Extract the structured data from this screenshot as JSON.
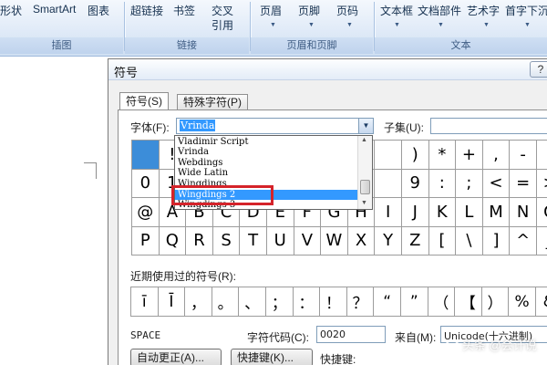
{
  "ribbon": {
    "items": [
      "形状",
      "SmartArt",
      "图表",
      "超链接",
      "书签",
      "交叉",
      "引用",
      "页眉",
      "页脚",
      "页码",
      "文本框",
      "文档部件",
      "艺术字",
      "首字下沉"
    ],
    "groups": [
      "插图",
      "链接",
      "页眉和页脚",
      "文本"
    ]
  },
  "dialog": {
    "title": "符号",
    "help": "?",
    "tabs": [
      "符号(S)",
      "特殊字符(P)"
    ],
    "font_label": "字体(F):",
    "font_value": "Vrinda",
    "subset_label": "子集(U):",
    "font_list": [
      "Vladimir Script",
      "Vrinda",
      "Webdings",
      "Wide Latin",
      "Wingdings",
      "Wingdings 2",
      "Wingdings 3"
    ],
    "font_list_highlight": "Wingdings 2",
    "symbols": [
      [
        "",
        "!",
        "",
        "",
        "",
        "",
        "",
        "",
        "",
        "",
        ")",
        "*",
        "+",
        ",",
        "-",
        "."
      ],
      [
        "0",
        "1",
        "",
        "",
        "",
        "",
        "",
        "",
        "",
        "",
        "9",
        ":",
        ";",
        "<",
        "=",
        ">"
      ],
      [
        "@",
        "A",
        "B",
        "C",
        "D",
        "E",
        "F",
        "G",
        "H",
        "I",
        "J",
        "K",
        "L",
        "M",
        "N",
        "O"
      ],
      [
        "P",
        "Q",
        "R",
        "S",
        "T",
        "U",
        "V",
        "W",
        "X",
        "Y",
        "Z",
        "[",
        "\\",
        "]",
        "^",
        "_"
      ]
    ],
    "recent_label": "近期使用过的符号(R):",
    "recent_symbols": [
      "ī",
      "Ī",
      "，",
      "。",
      "、",
      "；",
      "：",
      "！",
      "？",
      "“",
      "”",
      "（",
      "【",
      "）",
      "%",
      "&"
    ],
    "char_name": "SPACE",
    "char_code_label": "字符代码(C):",
    "char_code_value": "0020",
    "from_label": "来自(M):",
    "from_value": "Unicode(十六进制)",
    "autocorrect_button": "自动更正(A)...",
    "shortcut_button": "快捷键(K)...",
    "shortcut_label": "快捷键:"
  },
  "watermark": "头条 @会计说"
}
